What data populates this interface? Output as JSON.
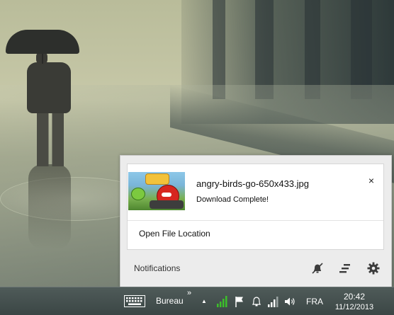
{
  "notification": {
    "title": "angry-birds-go-650x433.jpg",
    "message": "Download Complete!",
    "action_label": "Open File Location",
    "close_glyph": "×",
    "thumbnail_icon": "image-thumbnail-angry-birds"
  },
  "notification_center": {
    "footer_label": "Notifications",
    "icons": [
      "do-not-disturb-icon",
      "clear-all-icon",
      "settings-gear-icon"
    ]
  },
  "taskbar": {
    "toolbar_label": "Bureau",
    "expand_glyph": "»",
    "tray_up_glyph": "▲",
    "language": "FRA",
    "time": "20:42",
    "date": "11/12/2013",
    "tray_icons": [
      "touch-keyboard-icon",
      "show-hidden-icons",
      "network-signal-icon",
      "flag-icon",
      "notification-bell-icon",
      "network-bars-icon",
      "volume-icon"
    ]
  },
  "colors": {
    "taskbar": "#3f4a49",
    "panel": "#ececec",
    "card": "#ffffff",
    "signal_green": "#3cbf2a"
  }
}
